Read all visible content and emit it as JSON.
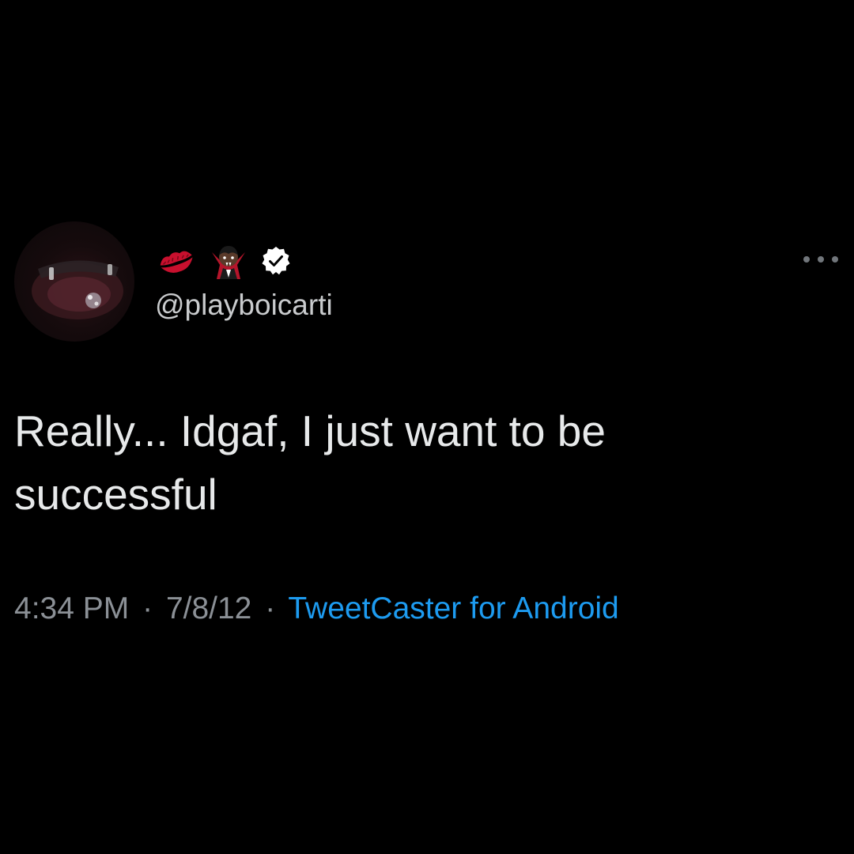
{
  "tweet": {
    "author": {
      "handle": "@playboicarti",
      "name_emojis": [
        "kiss-mark-icon",
        "vampire-icon"
      ],
      "verified": true
    },
    "text": "Really... Idgaf, I just want to be successful",
    "time": "4:34 PM",
    "separator": "·",
    "date": "7/8/12",
    "source": "TweetCaster for Android"
  },
  "colors": {
    "background": "#000000",
    "text_primary": "#e7e9ea",
    "text_secondary": "#8b9096",
    "link": "#1d9bf0",
    "verified_badge": "#ffffff"
  }
}
